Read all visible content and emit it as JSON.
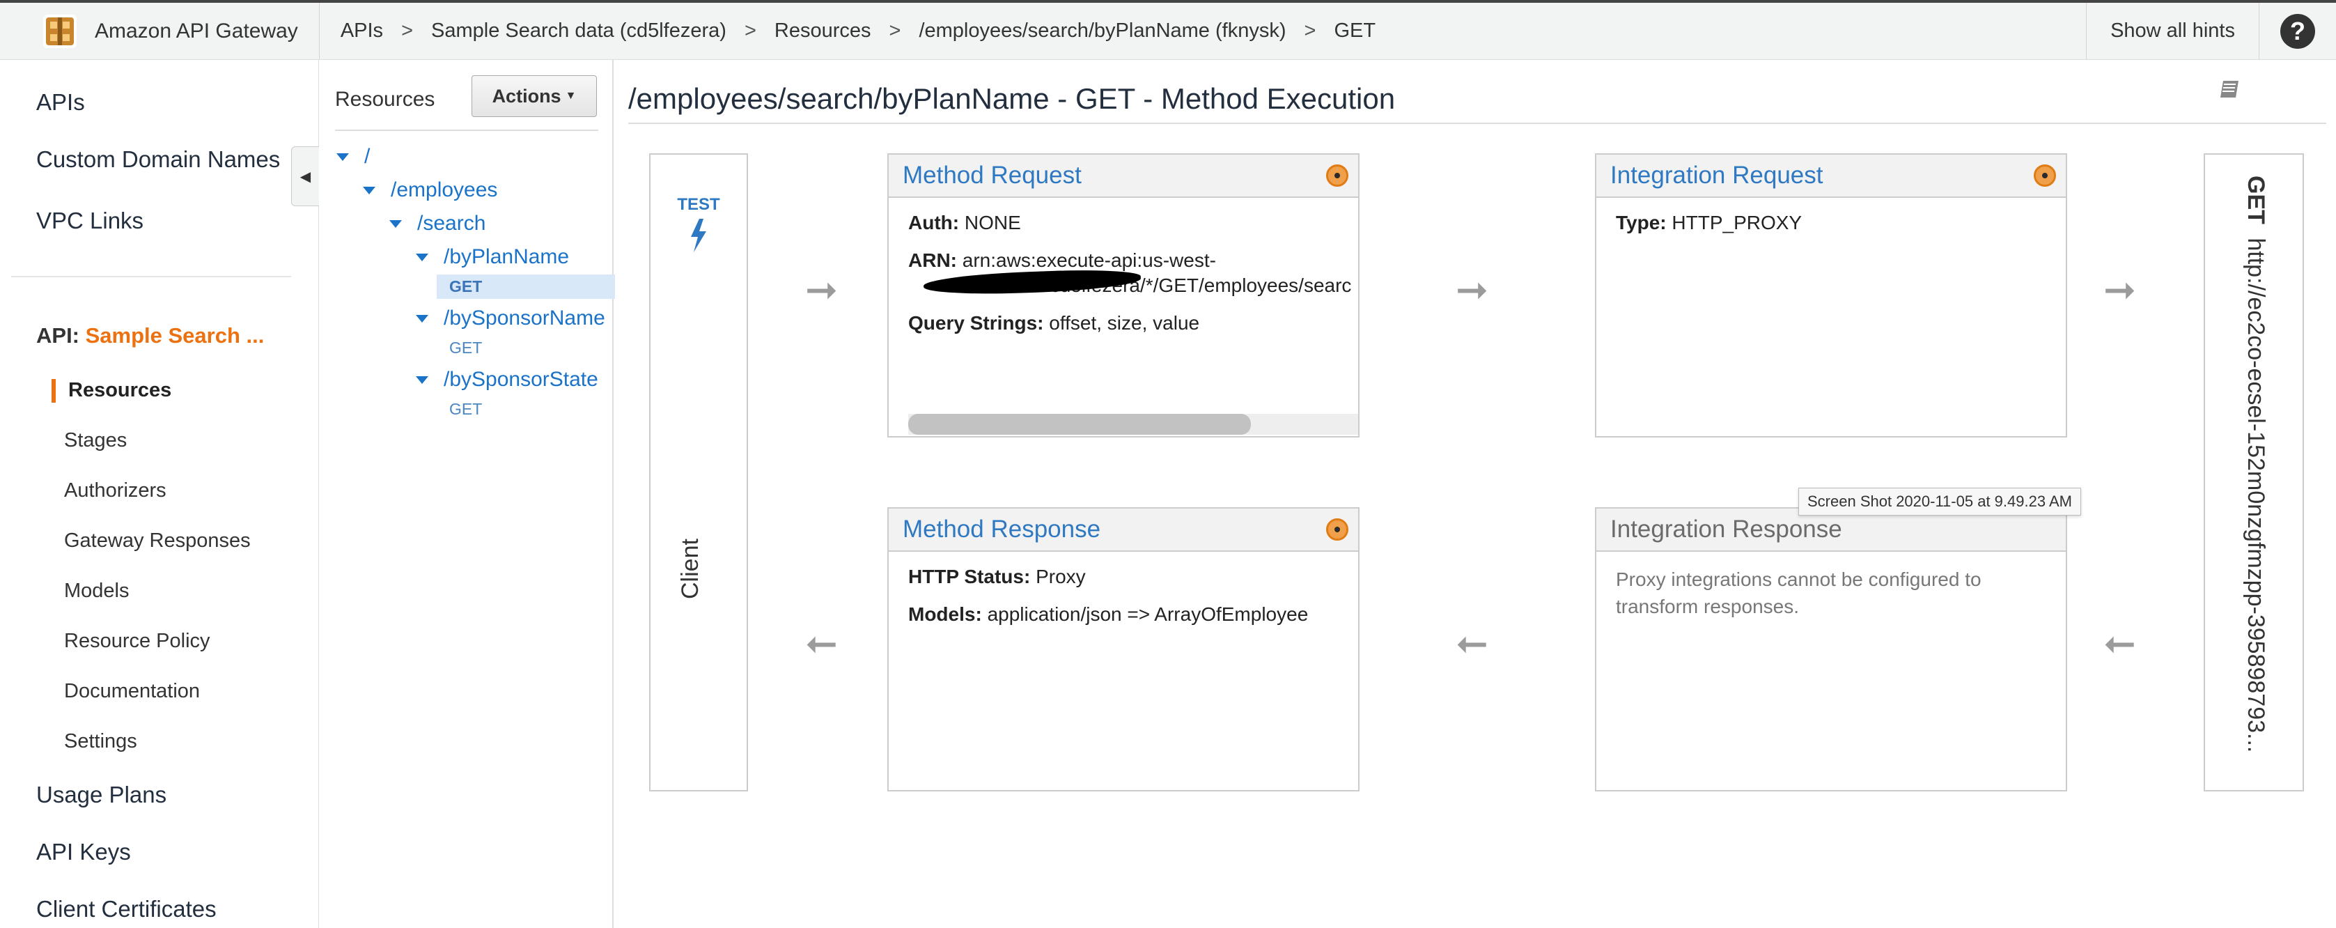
{
  "header": {
    "brand": "Amazon API Gateway",
    "breadcrumbs": [
      "APIs",
      "Sample Search data (cd5lfezera)",
      "Resources",
      "/employees/search/byPlanName (fknysk)",
      "GET"
    ],
    "separator": ">",
    "hints_label": "Show all hints",
    "help_label": "?"
  },
  "nav": {
    "top_items": [
      "APIs",
      "Custom Domain Names",
      "VPC Links"
    ],
    "api_prefix": "API:",
    "api_name": "Sample Search ...",
    "sub_items": [
      "Resources",
      "Stages",
      "Authorizers",
      "Gateway Responses",
      "Models",
      "Resource Policy",
      "Documentation",
      "Settings"
    ],
    "bottom_items": [
      "Usage Plans",
      "API Keys",
      "Client Certificates"
    ]
  },
  "tree": {
    "title": "Resources",
    "actions_label": "Actions",
    "nodes": [
      "/",
      "/employees",
      "/search",
      "/byPlanName",
      "/bySponsorName",
      "/bySponsorState"
    ],
    "methods": [
      "GET",
      "GET",
      "GET"
    ]
  },
  "main": {
    "title": "/employees/search/byPlanName - GET - Method Execution",
    "client": {
      "test_label": "TEST",
      "label": "Client"
    },
    "method_request": {
      "title": "Method Request",
      "auth_label": "Auth:",
      "auth_value": "NONE",
      "arn_label": "ARN:",
      "arn_line1": "arn:aws:execute-api:us-west-",
      "arn_line2": ":cd5lfezera/*/GET/employees/searc",
      "query_label": "Query Strings:",
      "query_value": "offset, size, value"
    },
    "integration_request": {
      "title": "Integration Request",
      "type_label": "Type:",
      "type_value": "HTTP_PROXY"
    },
    "method_response": {
      "title": "Method Response",
      "status_label": "HTTP Status:",
      "status_value": "Proxy",
      "models_label": "Models:",
      "models_value": "application/json => ArrayOfEmployee"
    },
    "integration_response": {
      "title": "Integration Response",
      "body": "Proxy integrations cannot be configured to transform responses."
    },
    "endpoint": {
      "method": "GET",
      "url": "http://ec2co-ecsel-152m0nzgfmzpp-395898793..."
    },
    "tooltip": "Screen Shot 2020-11-05 at 9.49.23 AM"
  },
  "colors": {
    "accent": "#ec7211",
    "link": "#2f79c2"
  }
}
